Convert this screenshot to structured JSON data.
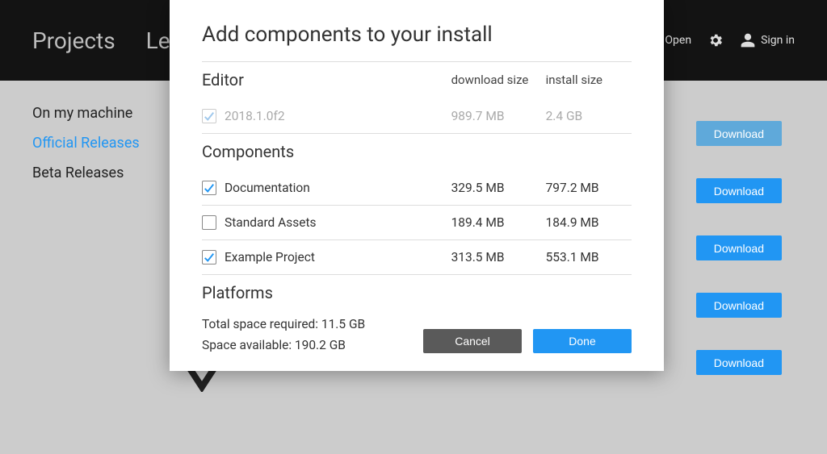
{
  "header": {
    "nav": {
      "projects": "Projects",
      "learn": "Learn"
    },
    "open": "Open",
    "signin": "Sign in"
  },
  "sidebar": {
    "items": [
      {
        "label": "On my machine",
        "active": false
      },
      {
        "label": "Official Releases",
        "active": true
      },
      {
        "label": "Beta Releases",
        "active": false
      }
    ]
  },
  "download_buttons": [
    {
      "label": "Download",
      "muted": true
    },
    {
      "label": "Download",
      "muted": false
    },
    {
      "label": "Download",
      "muted": false
    },
    {
      "label": "Download",
      "muted": false
    },
    {
      "label": "Download",
      "muted": false
    }
  ],
  "modal": {
    "title": "Add components to your install",
    "columns": {
      "download": "download size",
      "install": "install size"
    },
    "sections": {
      "editor": "Editor",
      "components": "Components",
      "platforms": "Platforms"
    },
    "editor_row": {
      "name": "2018.1.0f2",
      "download": "989.7 MB",
      "install": "2.4 GB",
      "checked": true,
      "disabled": true
    },
    "components_rows": [
      {
        "name": "Documentation",
        "download": "329.5 MB",
        "install": "797.2 MB",
        "checked": true
      },
      {
        "name": "Standard Assets",
        "download": "189.4 MB",
        "install": "184.9 MB",
        "checked": false
      },
      {
        "name": "Example Project",
        "download": "313.5 MB",
        "install": "553.1 MB",
        "checked": true
      }
    ],
    "totals": {
      "required": "Total space required: 11.5 GB",
      "available": "Space available: 190.2 GB"
    },
    "buttons": {
      "cancel": "Cancel",
      "done": "Done"
    }
  }
}
